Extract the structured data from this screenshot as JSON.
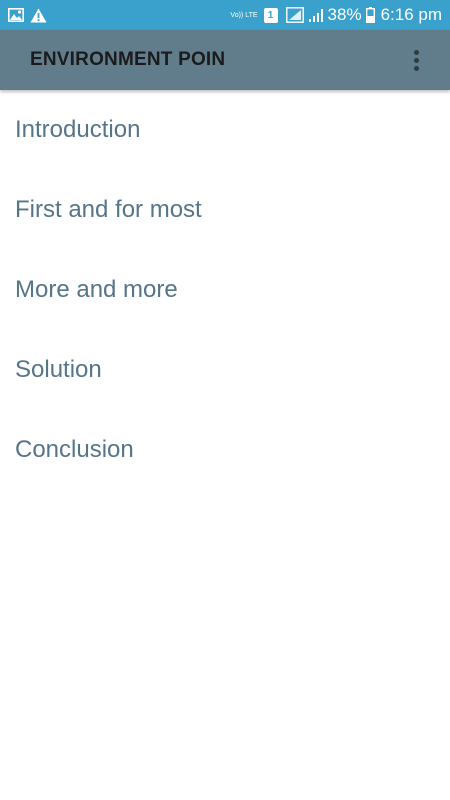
{
  "status_bar": {
    "left_icons": [
      "image-icon",
      "warning-icon"
    ],
    "network_label": "Vo)) LTE",
    "sim_slot": "1",
    "battery_percent": "38%",
    "time": "6:16 pm"
  },
  "app_bar": {
    "title": "ENVIRONMENT POIN",
    "overflow_icon": "more-vert-icon"
  },
  "menu": {
    "items": [
      {
        "label": "Introduction"
      },
      {
        "label": "First and for most"
      },
      {
        "label": "More and more"
      },
      {
        "label": "Solution"
      },
      {
        "label": "Conclusion"
      }
    ]
  },
  "colors": {
    "status_bar_bg": "#3aa0cc",
    "app_bar_bg": "#617d8c",
    "menu_text": "#557588"
  }
}
